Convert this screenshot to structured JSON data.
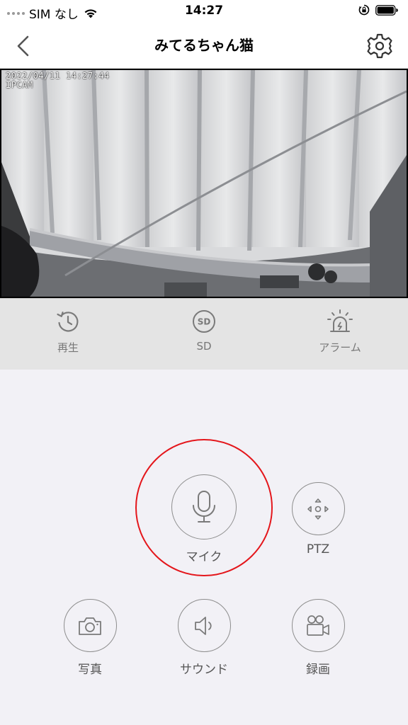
{
  "status_bar": {
    "carrier": "SIM なし",
    "time": "14:27"
  },
  "nav": {
    "title": "みてるちゃん猫",
    "back_icon": "chevron-left-icon",
    "settings_icon": "gear-icon"
  },
  "video": {
    "osd_timestamp": "2022/04/11 14:27:44",
    "osd_camera": "IPCAM"
  },
  "toolbar": {
    "items": [
      {
        "label": "再生",
        "icon": "history-icon"
      },
      {
        "label": "SD",
        "icon": "sd-icon",
        "icon_text": "SD"
      },
      {
        "label": "アラーム",
        "icon": "alarm-icon"
      }
    ]
  },
  "controls": {
    "mic": {
      "label": "マイク",
      "icon": "microphone-icon"
    },
    "ptz": {
      "label": "PTZ",
      "icon": "ptz-icon"
    },
    "photo": {
      "label": "写真",
      "icon": "camera-icon"
    },
    "sound": {
      "label": "サウンド",
      "icon": "speaker-icon"
    },
    "record": {
      "label": "録画",
      "icon": "video-camera-icon"
    }
  },
  "colors": {
    "highlight": "#e4161b",
    "background": "#f2f1f6",
    "toolbar": "#e4e4e4"
  }
}
